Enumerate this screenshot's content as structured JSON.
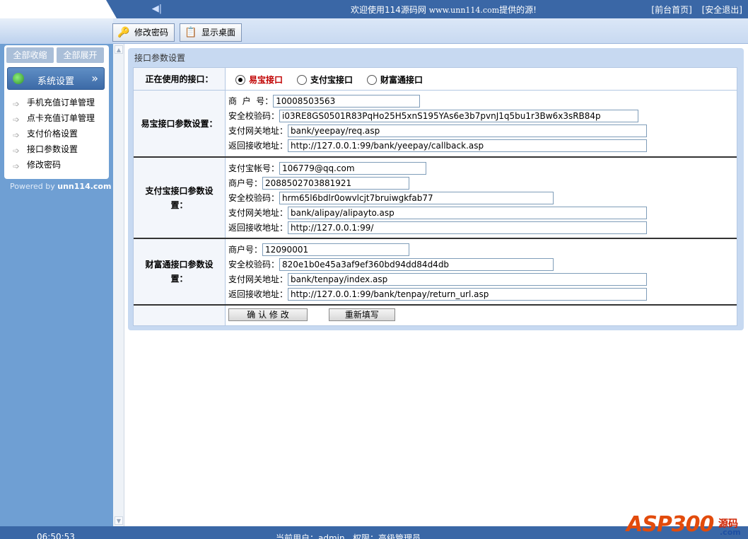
{
  "header": {
    "welcome": "欢迎使用114源码网",
    "welcome_url": "www.unn114.com",
    "welcome_suffix": "提供的源!",
    "link_home": "[前台首页]",
    "link_logout": "[安全退出]"
  },
  "tabs": [
    {
      "label": "修改密码",
      "icon": "key-icon"
    },
    {
      "label": "显示桌面",
      "icon": "desktop-icon"
    }
  ],
  "sidebar": {
    "collapse_all": "全部收缩",
    "expand_all": "全部展开",
    "section_title": "系统设置",
    "items": [
      {
        "label": "手机充值订单管理"
      },
      {
        "label": "点卡充值订单管理"
      },
      {
        "label": "支付价格设置"
      },
      {
        "label": "接口参数设置"
      },
      {
        "label": "修改密码"
      }
    ],
    "powered_prefix": "Powered by",
    "powered_brand": "unn114.com"
  },
  "main": {
    "panel_title": "接口参数设置",
    "active_label": "正在使用的接口：",
    "radios": [
      {
        "label": "易宝接口",
        "selected": true
      },
      {
        "label": "支付宝接口",
        "selected": false
      },
      {
        "label": "财富通接口",
        "selected": false
      }
    ],
    "yeepay": {
      "section_label": "易宝接口参数设置：",
      "merchant_key": "商  户  号：",
      "merchant_value": "10008503563",
      "secret_key": "安全校验码：",
      "secret_value": "i03RE8GS0501R83PqHo25H5xnS195YAs6e3b7pvnJ1q5bu1r3Bw6x3sRB84p",
      "gateway_key": "支付网关地址：",
      "gateway_value": "bank/yeepay/req.asp",
      "callback_key": "返回接收地址：",
      "callback_value": "http://127.0.0.1:99/bank/yeepay/callback.asp"
    },
    "alipay": {
      "section_label": "支付宝接口参数设置：",
      "account_key": "支付宝帐号：",
      "account_value": "106779@qq.com",
      "merchant_key": "商户号：",
      "merchant_value": "2088502703881921",
      "secret_key": "安全校验码：",
      "secret_value": "hrm65l6bdlr0owvlcjt7bruiwgkfab77",
      "gateway_key": "支付网关地址：",
      "gateway_value": "bank/alipay/alipayto.asp",
      "callback_key": "返回接收地址：",
      "callback_value": "http://127.0.0.1:99/"
    },
    "tenpay": {
      "section_label": "财富通接口参数设置：",
      "merchant_key": "商户号：",
      "merchant_value": "12090001",
      "secret_key": "安全校验码：",
      "secret_value": "820e1b0e45a3af9ef360bd94dd84d4db",
      "gateway_key": "支付网关地址：",
      "gateway_value": "bank/tenpay/index.asp",
      "callback_key": "返回接收地址：",
      "callback_value": "http://127.0.0.1:99/bank/tenpay/return_url.asp"
    },
    "submit_label": "确 认 修 改",
    "reset_label": "重新填写"
  },
  "footer": {
    "time": "06:50:53",
    "user_info": "当前用户：admin   权限：高级管理员"
  },
  "watermark": {
    "brand": "ASP300",
    "suffix": "源码",
    "site": ".com"
  },
  "colors": {
    "topbar": "#3a67a6",
    "sidebar": "#6f9fd3",
    "selected_radio": "#c00000"
  }
}
